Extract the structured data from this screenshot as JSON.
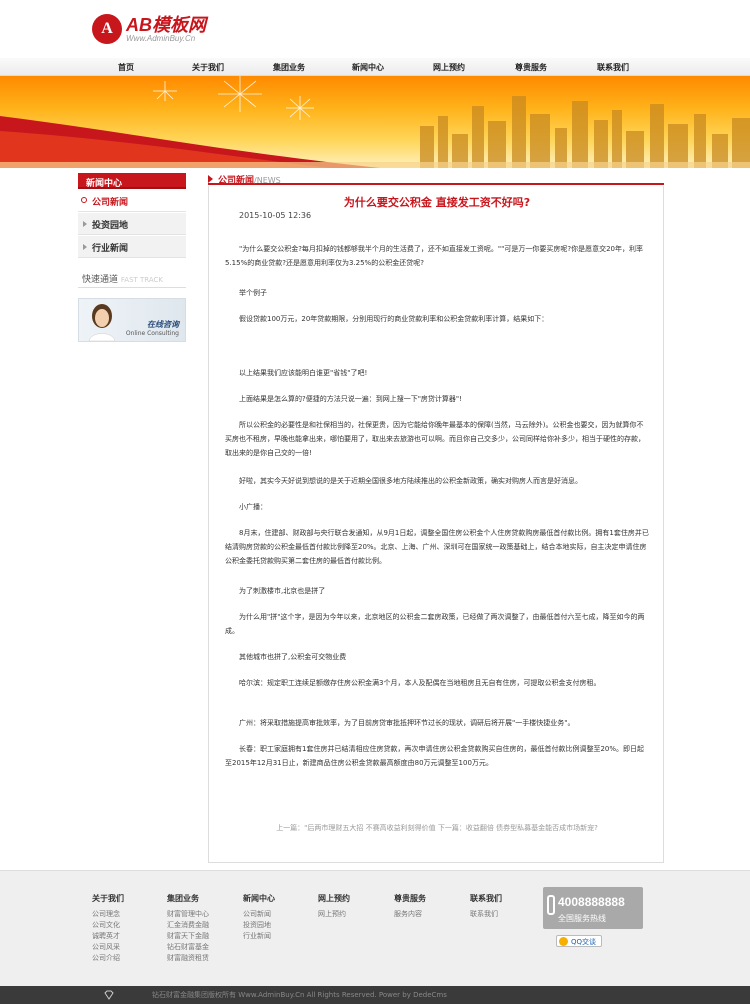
{
  "brand": {
    "mark": "A",
    "title": "AB模板网",
    "subtitle": "Www.AdminBuy.Cn"
  },
  "nav": [
    {
      "label": "首页"
    },
    {
      "label": "关于我们"
    },
    {
      "label": "集团业务"
    },
    {
      "label": "新闻中心"
    },
    {
      "label": "网上预约"
    },
    {
      "label": "尊贵服务"
    },
    {
      "label": "联系我们"
    }
  ],
  "sidebar": {
    "title": "新闻中心",
    "items": [
      {
        "label": "公司新闻"
      },
      {
        "label": "投资园地"
      },
      {
        "label": "行业新闻"
      }
    ],
    "quick": "快速通道",
    "quick_en": "FAST TRACK",
    "consult": "在线咨询",
    "consult_en": "Online Consulting"
  },
  "section": {
    "title": "公司新闻",
    "title_en": "/NEWS"
  },
  "article": {
    "title": "为什么要交公积金 直接发工资不好吗?",
    "date": "2015-10-05 12:36",
    "paragraphs": [
      "\"为什么要交公积金?每月扣掉的钱都够我半个月的生活费了，还不如直接发工资呢。\"\"可是万一你要买房呢?你是愿意交20年，利率5.15%的商业贷款?还是愿意用利率仅为3.25%的公积金还贷呢?",
      "举个例子",
      "假设贷款100万元，20年贷款期限，分别用现行的商业贷款利率和公积金贷款利率计算，结果如下：",
      "以上结果我们应该能明白谁更\"省钱\"了吧!",
      "上面结果是怎么算的?便捷的方法只说一遍：到网上搜一下\"房贷计算器\"!",
      "所以公积金的必要性是和社保相当的，社保更贵，因为它能给你晚年最基本的保障(当然，马云除外)。公积金也要交，因为就算你不买房也不租房，早晚也能拿出来，哪怕要用了，取出来去旅游也可以啊。而且你自己交多少，公司同样给你补多少，相当于硬性的存款，取出来的是你自己交的一倍!",
      "好啦，其实今天好说到想说的是关于近期全国很多地方陆续推出的公积金新政策，确实对购房人而言是好消息。",
      "小广播：",
      "8月末，住建部、财政部与央行联合发通知，从9月1日起，调整全国住房公积金个人住房贷款购房最低首付款比例。拥有1套住房并已结清购房贷款的公积金最低首付款比例降至20%。北京、上海、广州、深圳可在国家统一政策基础上，结合本地实际，自主决定申请住房公积金委托贷款购买第二套住房的最低首付款比例。",
      "为了刺激楼市,北京也是拼了",
      "为什么用\"拼\"这个字，是因为今年以来，北京地区的公积金二套房政策，已经做了两次调整了，由最低首付六至七成，降至如今的两成。",
      "其他城市也拼了,公积金可交物业费",
      "哈尔滨：规定职工连续足额缴存住房公积金满3个月，本人及配偶在当地租房且无自有住房，可提取公积金支付房租。",
      "广州：将采取措施提高审批效率，为了目前房贷审批抵押环节过长的现状，调研后将开展\"一手楼快捷业务\"。",
      "长春：职工家庭拥有1套住房并已结清相应住房贷款，再次申请住房公积金贷款购买自住房的，最低首付款比例调整至20%。即日起至2015年12月31日止，新建商品住房公积金贷款最高额度由80万元调整至100万元。"
    ],
    "prev_next": "上一篇：\"后两市理财五大招 不赛高收益利刻得价值  下一篇：收益翻倍 债券型私募基金能否成市场新宠?"
  },
  "footer": {
    "columns": [
      {
        "title": "关于我们",
        "items": [
          "公司理念",
          "公司文化",
          "诚聘英才",
          "公司风采",
          "公司介绍"
        ]
      },
      {
        "title": "集团业务",
        "items": [
          "财富管理中心",
          "汇金消费金融",
          "财富天下金融",
          "钻石财富基金",
          "财富融资租赁"
        ]
      },
      {
        "title": "新闻中心",
        "items": [
          "公司新闻",
          "投资园地",
          "行业新闻"
        ]
      },
      {
        "title": "网上预约",
        "items": [
          "网上预约"
        ]
      },
      {
        "title": "尊贵服务",
        "items": [
          "服务内容"
        ]
      },
      {
        "title": "联系我们",
        "items": [
          "联系我们"
        ]
      }
    ],
    "hotline_number": "4008888888",
    "hotline_label": "全国服务热线",
    "qq_label": "QQ交谈",
    "copyright": "钻石财富金融集团版权所有 Www.AdminBuy.Cn All Rights Reserved. Power by DedeCms"
  }
}
